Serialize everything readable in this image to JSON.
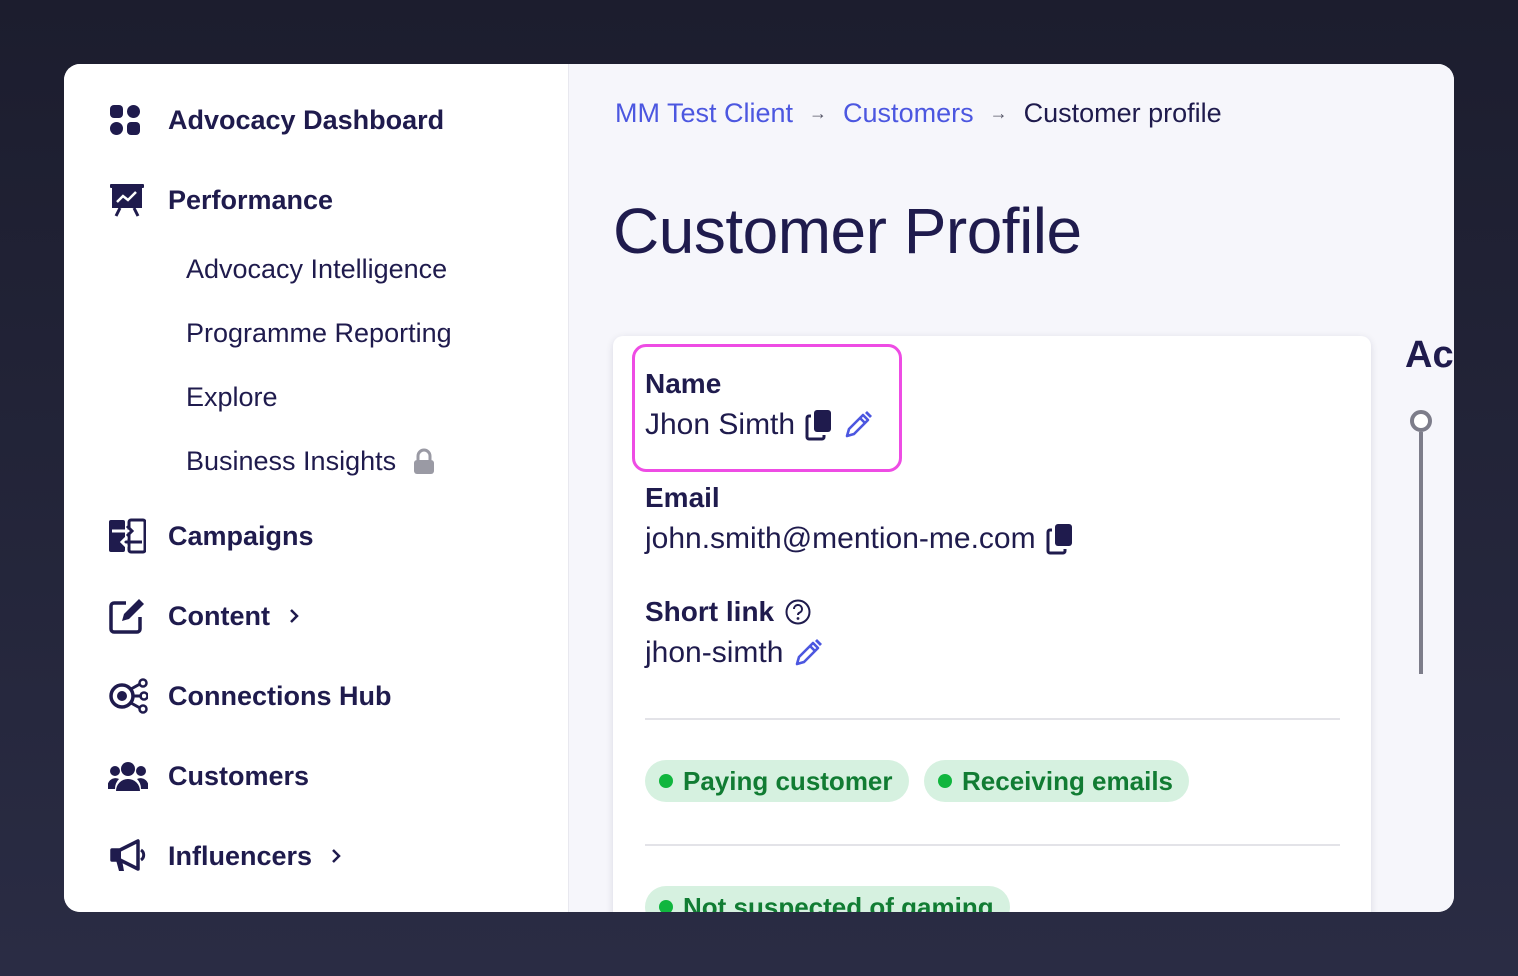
{
  "sidebar": {
    "items": [
      {
        "label": "Advocacy Dashboard",
        "icon": "dashboard-grid-icon"
      },
      {
        "label": "Performance",
        "icon": "presentation-chart-icon"
      },
      {
        "label": "Campaigns",
        "icon": "arrows-exchange-icon"
      },
      {
        "label": "Content",
        "icon": "edit-square-icon"
      },
      {
        "label": "Connections Hub",
        "icon": "connections-hub-icon"
      },
      {
        "label": "Customers",
        "icon": "users-group-icon"
      },
      {
        "label": "Influencers",
        "icon": "megaphone-icon"
      }
    ],
    "subitems": [
      {
        "label": "Advocacy Intelligence"
      },
      {
        "label": "Programme Reporting"
      },
      {
        "label": "Explore"
      },
      {
        "label": "Business Insights",
        "icon": "lock-icon"
      }
    ]
  },
  "breadcrumb": {
    "items": [
      "MM Test Client",
      "Customers"
    ],
    "current": "Customer profile"
  },
  "page": {
    "title": "Customer Profile"
  },
  "profile": {
    "name_label": "Name",
    "name_value": "Jhon Simth",
    "email_label": "Email",
    "email_value": "john.smith@mention-me.com",
    "shortlink_label": "Short link",
    "shortlink_value": "jhon-simth"
  },
  "badges": [
    "Paying customer",
    "Receiving emails",
    "Not suspected of gaming"
  ],
  "activity": {
    "title": "Ac"
  },
  "colors": {
    "primary_text": "#1f1b4d",
    "link": "#4c57e0",
    "highlight": "#ee4ce4",
    "badge_bg": "#d6f1e0",
    "badge_text": "#117c33",
    "badge_dot": "#10b63e"
  }
}
